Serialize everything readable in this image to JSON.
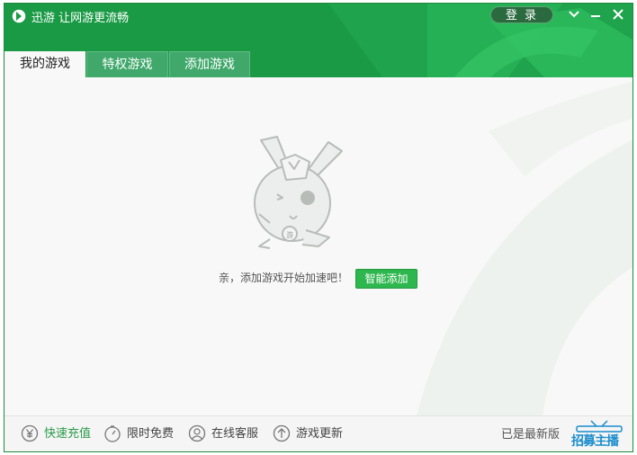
{
  "app": {
    "title": "迅游 让网游更流畅",
    "login_label": "登 录",
    "controls": {
      "menu_icon": "chevron-down-icon",
      "minimize_icon": "minimize-icon",
      "close_icon": "close-icon"
    }
  },
  "tabs": [
    {
      "label": "我的游戏",
      "active": true
    },
    {
      "label": "特权游戏",
      "active": false
    },
    {
      "label": "添加游戏",
      "active": false
    }
  ],
  "main": {
    "prompt": "亲，添加游戏开始加速吧！",
    "smart_add_label": "智能添加",
    "mascot_badge": "游"
  },
  "footer": {
    "items": [
      {
        "label": "快速充值",
        "icon": "yuan-icon",
        "color": "#2a9a4a"
      },
      {
        "label": "限时免费",
        "icon": "stopwatch-icon",
        "color": "#444444"
      },
      {
        "label": "在线客服",
        "icon": "headset-user-icon",
        "color": "#444444"
      },
      {
        "label": "游戏更新",
        "icon": "upload-arrow-icon",
        "color": "#444444"
      }
    ],
    "version_text": "已是最新版",
    "promo_text": "招募主播"
  },
  "colors": {
    "brand_green": "#1a9a45",
    "button_green": "#2fb74f",
    "promo_blue": "#1a8ccd"
  }
}
